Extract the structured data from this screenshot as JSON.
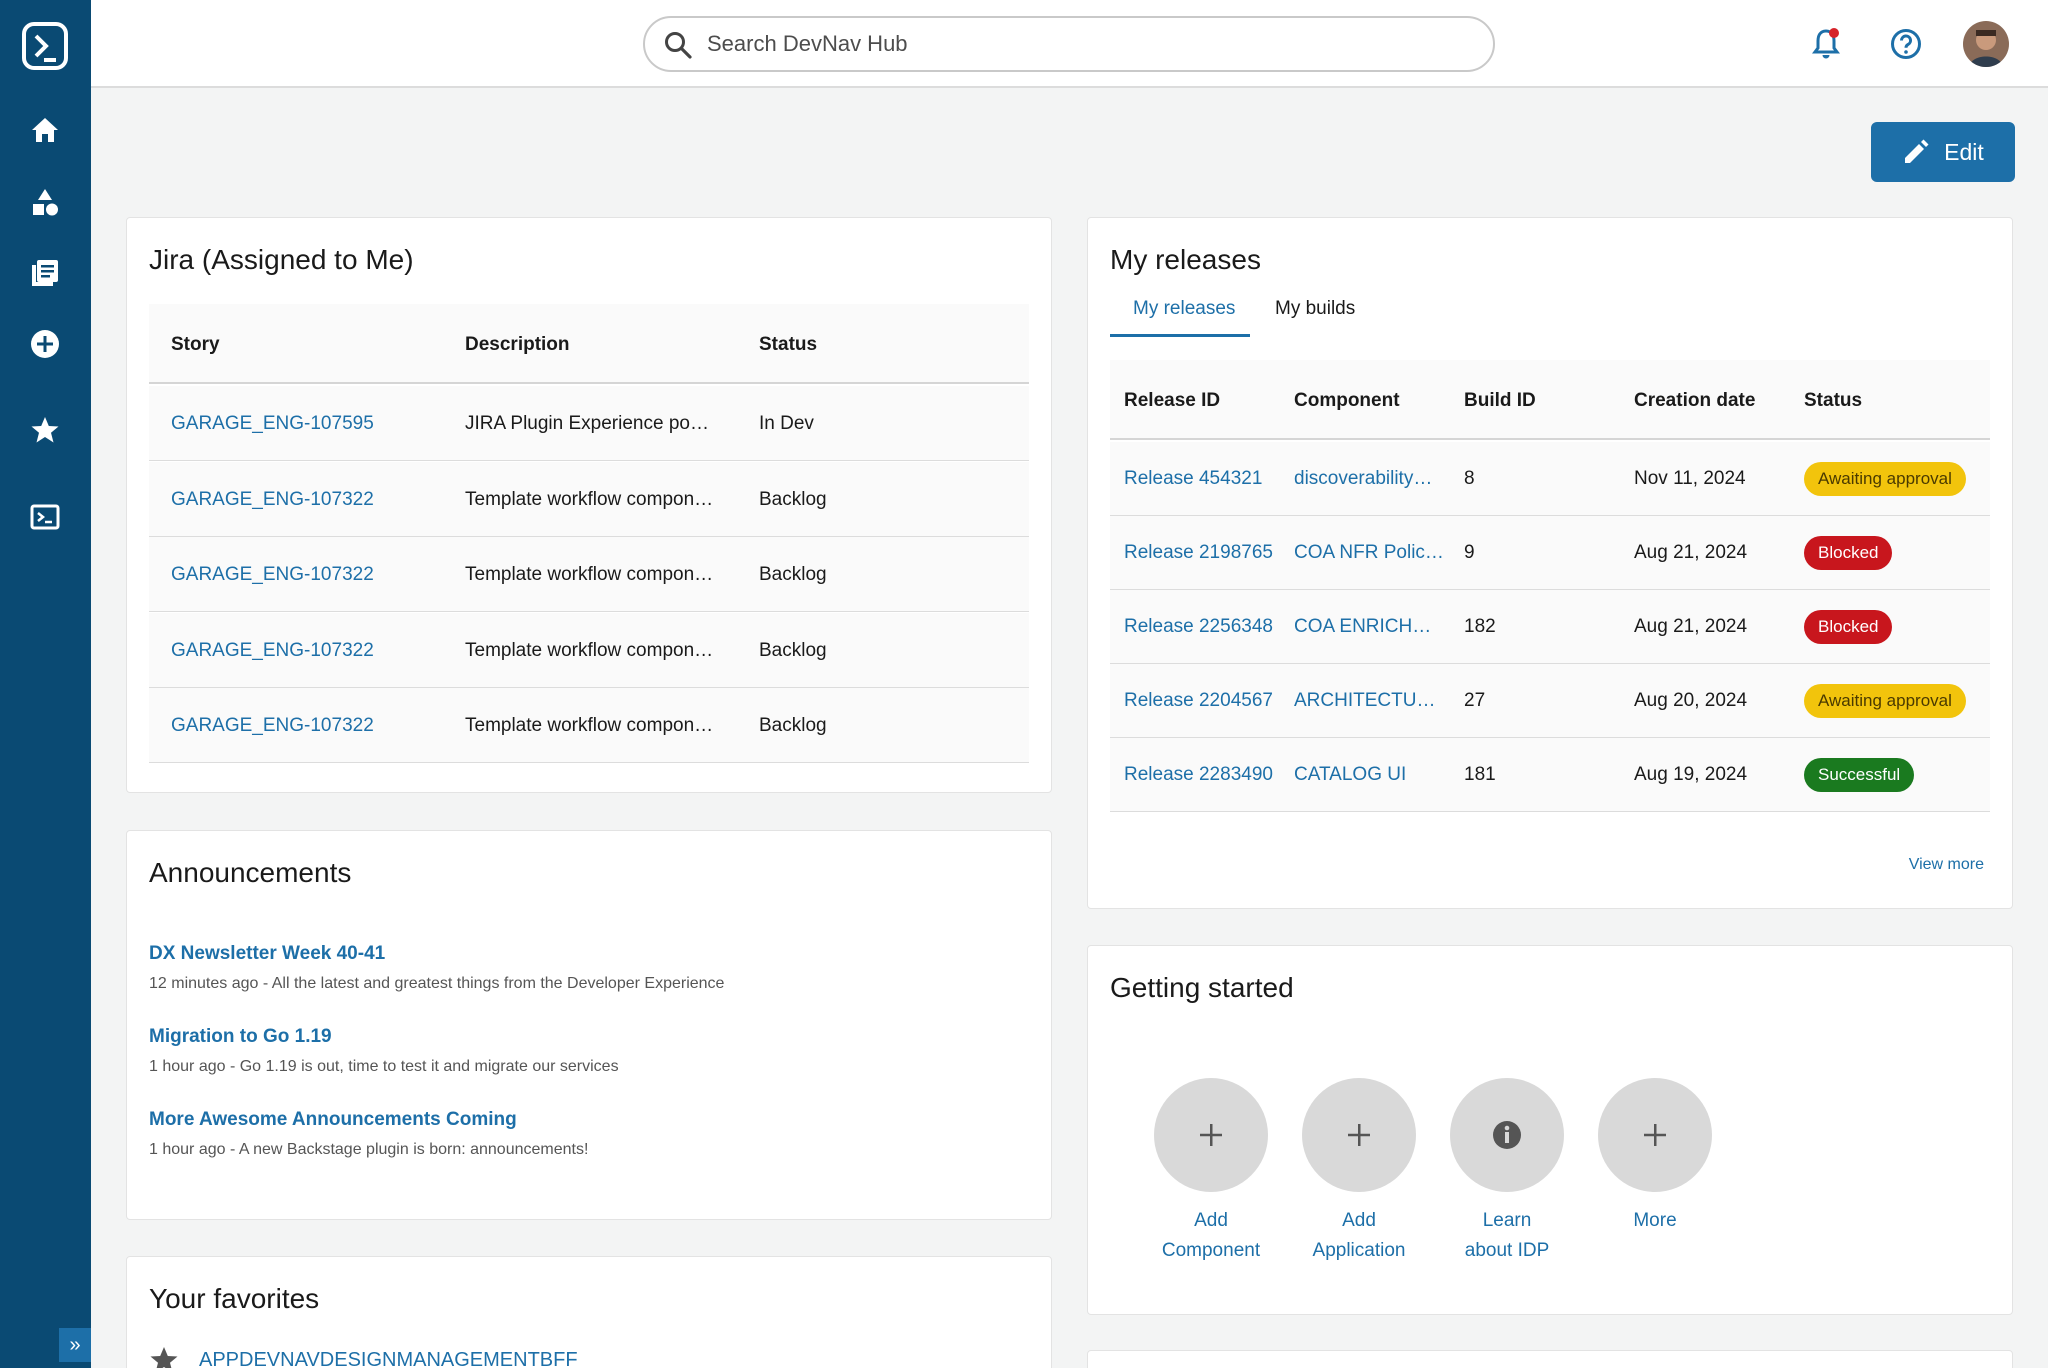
{
  "search": {
    "placeholder": "Search DevNav Hub"
  },
  "edit_label": "Edit",
  "jira": {
    "title": "Jira (Assigned to Me)",
    "columns": [
      "Story",
      "Description",
      "Status"
    ],
    "rows": [
      {
        "story": "GARAGE_ENG-107595",
        "description": "JIRA Plugin Experience port…",
        "status": "In Dev"
      },
      {
        "story": "GARAGE_ENG-107322",
        "description": "Template workflow component",
        "status": "Backlog"
      },
      {
        "story": "GARAGE_ENG-107322",
        "description": "Template workflow component",
        "status": "Backlog"
      },
      {
        "story": "GARAGE_ENG-107322",
        "description": "Template workflow component",
        "status": "Backlog"
      },
      {
        "story": "GARAGE_ENG-107322",
        "description": "Template workflow component",
        "status": "Backlog"
      }
    ]
  },
  "releases": {
    "title": "My releases",
    "tabs": [
      "My releases",
      "My builds"
    ],
    "columns": [
      "Release ID",
      "Component",
      "Build ID",
      "Creation date",
      "Status"
    ],
    "rows": [
      {
        "id": "Release 454321",
        "component": "discoverability…",
        "build": "8",
        "date": "Nov 11, 2024",
        "status": "Awaiting approval",
        "kind": "await"
      },
      {
        "id": "Release 2198765",
        "component": "COA NFR Polic…",
        "build": "9",
        "date": "Aug 21, 2024",
        "status": "Blocked",
        "kind": "block"
      },
      {
        "id": "Release 2256348",
        "component": "COA ENRICHM…",
        "build": "182",
        "date": "Aug 21, 2024",
        "status": "Blocked",
        "kind": "block"
      },
      {
        "id": "Release 2204567",
        "component": "ARCHITECTUR…",
        "build": "27",
        "date": "Aug 20, 2024",
        "status": "Awaiting approval",
        "kind": "await"
      },
      {
        "id": "Release 2283490",
        "component": "CATALOG UI",
        "build": "181",
        "date": "Aug 19, 2024",
        "status": "Successful",
        "kind": "ok"
      }
    ],
    "view_more": "View more"
  },
  "announcements": {
    "title": "Announcements",
    "items": [
      {
        "title": "DX Newsletter Week 40-41",
        "time": "12 minutes ago",
        "text": "All the latest and greatest things from the Developer Experience"
      },
      {
        "title": "Migration to Go 1.19",
        "time": "1 hour ago",
        "text": "Go 1.19 is out, time to test it and migrate our services"
      },
      {
        "title": "More Awesome Announcements Coming",
        "time": "1 hour ago",
        "text": "A new Backstage plugin is born: announcements!"
      }
    ]
  },
  "getting_started": {
    "title": "Getting started",
    "items": [
      {
        "label1": "Add",
        "label2": "Component",
        "icon": "plus-icon"
      },
      {
        "label1": "Add",
        "label2": "Application",
        "icon": "plus-icon"
      },
      {
        "label1": "Learn",
        "label2": "about IDP",
        "icon": "info-icon"
      },
      {
        "label1": "More",
        "label2": "",
        "icon": "plus-icon"
      }
    ]
  },
  "favorites": {
    "title": "Your favorites",
    "items": [
      "APPDEVNAVDESIGNMANAGEMENTBFF"
    ]
  },
  "colors": {
    "sidebar": "#0a4a73",
    "accent": "#1d6fa8",
    "awaiting": "#f2c40c",
    "blocked": "#c8161d",
    "success": "#1a7a1f"
  }
}
